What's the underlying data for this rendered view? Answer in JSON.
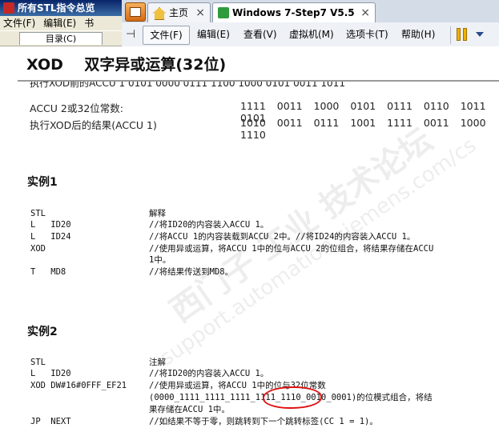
{
  "help_window": {
    "title": "所有STL指令总览",
    "menu": [
      "文件(F)",
      "编辑(E)",
      "书"
    ],
    "toc_tab": "目录(C)"
  },
  "vmware": {
    "tabs": [
      {
        "label": "主页",
        "icon": "home-icon"
      },
      {
        "label": "Windows 7-Step7 V5.5 +...",
        "icon": "vm-icon"
      }
    ],
    "tab_close": "×",
    "menu": [
      "文件(F)",
      "编辑(E)",
      "查看(V)",
      "虚拟机(M)",
      "选项卡(T)",
      "帮助(H)"
    ],
    "toolbar_icons": [
      "pin-icon",
      "pause-icon",
      "chevron-down-icon"
    ]
  },
  "page": {
    "title": "XOD    双字异或运算(32位)",
    "clipped_row": "执行XOD前的ACCU 1                          0101  0000  0111  1100  1000  0101  0011  1011",
    "rows": [
      {
        "label": "ACCU 2或32位常数:",
        "bits": "1111 0011 1000 0101 0111 0110 1011 0101"
      },
      {
        "label": "执行XOD后的结果(ACCU 1)",
        "bits": "1010 0011 0111 1001 1111 0011 1000 1110"
      }
    ],
    "example1": {
      "heading": "实例1",
      "lines": [
        {
          "code": "STL",
          "comment": "解释"
        },
        {
          "code": "L   ID20",
          "comment": "//将ID20的内容装入ACCU 1。"
        },
        {
          "code": "L   ID24",
          "comment": "//将ACCU 1的内容装载到ACCU 2中。//将ID24的内容装入ACCU 1。"
        },
        {
          "code": "XOD",
          "comment": "//使用异或运算，将ACCU 1中的位与ACCU 2的位组合，将结果存储在ACCU"
        },
        {
          "code": "",
          "comment": "1中。"
        },
        {
          "code": "T   MD8",
          "comment": "//将结果传送到MD8。"
        }
      ]
    },
    "example2": {
      "heading": "实例2",
      "lines": [
        {
          "code": "STL",
          "comment": "注解"
        },
        {
          "code": "L   ID20",
          "comment": "//将ID20的内容装入ACCU 1。"
        },
        {
          "code": "XOD DW#16#0FFF_EF21",
          "comment": "//使用异或运算，将ACCU 1中的位与32位常数"
        },
        {
          "code": "",
          "comment": "(0000_1111_1111_1111_1111_1110_0010_0001)的位模式组合，将结"
        },
        {
          "code": "",
          "comment": "果存储在ACCU 1中。"
        },
        {
          "code": "JP  NEXT",
          "comment": "//如结果不等于零，则跳转到下一个跳转标签(CC 1 = 1)。"
        }
      ]
    },
    "watermark": {
      "line1": "西门子 工业 技术论坛",
      "line2": "support.automation.siemens.com/cs"
    }
  },
  "colors": {
    "annotation_red": "#e01010",
    "title_bar": "#0a246a"
  }
}
